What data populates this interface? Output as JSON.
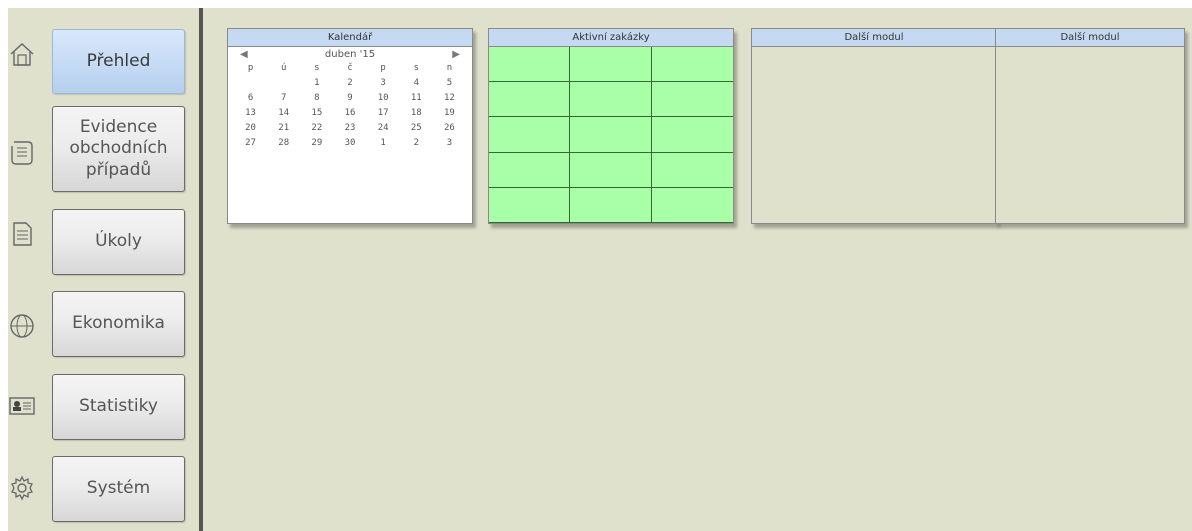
{
  "sidebar": {
    "items": [
      {
        "label": "Přehled",
        "icon": "home-icon",
        "active": true
      },
      {
        "label": "Evidence\nobchodních\npřípadů",
        "icon": "scroll-icon",
        "active": false
      },
      {
        "label": "Úkoly",
        "icon": "document-icon",
        "active": false
      },
      {
        "label": "Ekonomika",
        "icon": "globe-icon",
        "active": false
      },
      {
        "label": "Statistiky",
        "icon": "contact-card-icon",
        "active": false
      },
      {
        "label": "Systém",
        "icon": "gear-icon",
        "active": false
      }
    ]
  },
  "modules": {
    "calendar": {
      "title": "Kalendář",
      "month": "duben '15",
      "prev_icon": "triangle-left-icon",
      "next_icon": "triangle-right-icon",
      "weekdays": [
        "p",
        "ú",
        "s",
        "č",
        "p",
        "s",
        "n"
      ],
      "weeks": [
        [
          "",
          "",
          "1",
          "2",
          "3",
          "4",
          "5"
        ],
        [
          "6",
          "7",
          "8",
          "9",
          "10",
          "11",
          "12"
        ],
        [
          "13",
          "14",
          "15",
          "16",
          "17",
          "18",
          "19"
        ],
        [
          "20",
          "21",
          "22",
          "23",
          "24",
          "25",
          "26"
        ],
        [
          "27",
          "28",
          "29",
          "30",
          "1",
          "2",
          "3"
        ]
      ]
    },
    "active_orders": {
      "title": "Aktivní zakázky",
      "rows": 5,
      "cols": 3,
      "cell_color": "#a8ffa7"
    },
    "module3": {
      "title": "Další modul"
    },
    "module4": {
      "title": "Další modul"
    }
  },
  "colors": {
    "background": "#dfe1cc",
    "header": "#c6d9f2",
    "active_button": "#c7dcf5"
  }
}
